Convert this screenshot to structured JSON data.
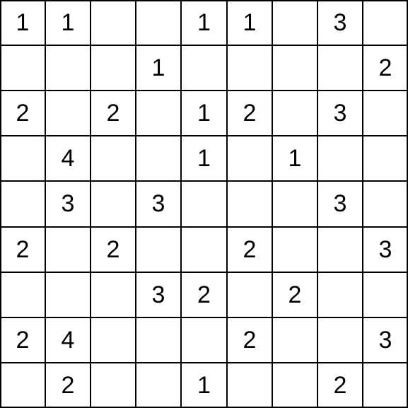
{
  "puzzle": {
    "rows": 9,
    "cols": 9,
    "cell_size": 64.11,
    "cells": [
      [
        "1",
        "1",
        "",
        "",
        "1",
        "1",
        "",
        "3",
        ""
      ],
      [
        "",
        "",
        "",
        "1",
        "",
        "",
        "",
        "",
        "2"
      ],
      [
        "2",
        "",
        "2",
        "",
        "1",
        "2",
        "",
        "3",
        ""
      ],
      [
        "",
        "4",
        "",
        "",
        "1",
        "",
        "1",
        "",
        ""
      ],
      [
        "",
        "3",
        "",
        "3",
        "",
        "",
        "",
        "3",
        ""
      ],
      [
        "2",
        "",
        "2",
        "",
        "",
        "2",
        "",
        "",
        "3"
      ],
      [
        "",
        "",
        "",
        "3",
        "2",
        "",
        "2",
        "",
        ""
      ],
      [
        "2",
        "4",
        "",
        "",
        "",
        "2",
        "",
        "",
        "3"
      ],
      [
        "",
        "2",
        "",
        "",
        "1",
        "",
        "",
        "2",
        ""
      ]
    ]
  }
}
